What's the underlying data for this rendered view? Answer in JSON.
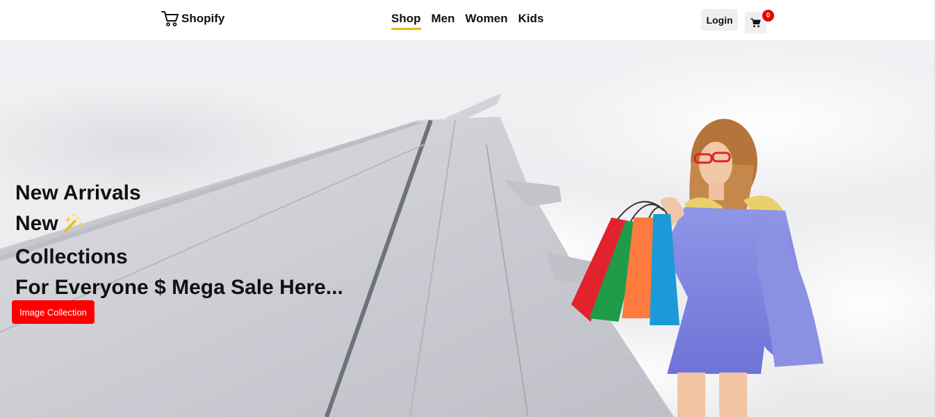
{
  "brand": {
    "name": "Shopify",
    "icon": "shopping-cart-icon"
  },
  "nav": {
    "items": [
      {
        "label": "Shop",
        "active": true
      },
      {
        "label": "Men",
        "active": false
      },
      {
        "label": "Women",
        "active": false
      },
      {
        "label": "Kids",
        "active": false
      }
    ],
    "active_color": "#e6b800"
  },
  "header": {
    "login_label": "Login",
    "cart_icon": "cart-icon",
    "cart_count": "0",
    "badge_color": "#e60000"
  },
  "hero": {
    "lines": [
      "New Arrivals",
      "New",
      "Collections",
      "For Everyone $ Mega Sale Here..."
    ],
    "decor_icon": "magic-wand-icon",
    "cta_label": "Image Collection",
    "cta_color": "#ff0000"
  }
}
